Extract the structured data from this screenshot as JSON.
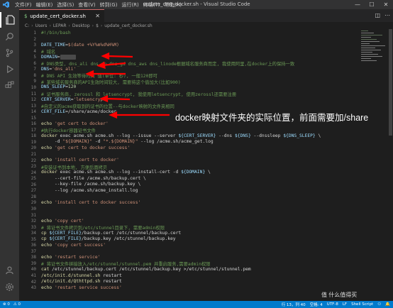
{
  "titlebar": {
    "menu": [
      "文件(F)",
      "编辑(E)",
      "选择(S)",
      "查看(V)",
      "转到(G)",
      "运行(R)",
      "终端(T)",
      "帮助(H)"
    ],
    "title": "update_cert_docker.sh - Visual Studio Code",
    "controls": [
      "—",
      "☐",
      "✕"
    ]
  },
  "tab": {
    "label": "update_cert_docker.sh",
    "icon_text": "$",
    "close": "✕"
  },
  "breadcrumb": [
    "C:",
    "Users",
    "LEPAR",
    "Desktop",
    "$",
    "update_cert_docker.sh"
  ],
  "editor": {
    "lines": [
      [
        [
          "#!/bin/bash",
          "comment"
        ]
      ],
      [],
      [
        [
          "DATE_TIME",
          "var"
        ],
        [
          "=",
          "op"
        ],
        [
          "$(date +%Y%m%d%H%M)",
          "str"
        ]
      ],
      [
        [
          "# 域名",
          "comment"
        ]
      ],
      [
        [
          "DOMAIN",
          "var"
        ],
        [
          "=",
          "op"
        ],
        [
          "██████",
          "blur"
        ]
      ],
      [
        [
          "# DNS类型, dns_ali dns_dp dns_gd dns_aws dns_linode根据域名服务商而定, 我使用阿里,在docker上的保持一致",
          "comment"
        ]
      ],
      [
        [
          "DNS",
          "var"
        ],
        [
          "=",
          "op"
        ],
        [
          "'dns_ali'",
          "str"
        ]
      ],
      [
        [
          "# DNS API 生效等待时间 值(单位: 秒), 一般120即可",
          "comment"
        ]
      ],
      [
        [
          "# 某些域名服务商的API生效时间较大, 需要将这个值加大(比如900)",
          "comment"
        ]
      ],
      [
        [
          "DNS_SLEEP",
          "var"
        ],
        [
          "=",
          "op"
        ],
        [
          "120",
          "num"
        ]
      ],
      [
        [
          "# 证书服务商, zerossl 和 letsencrypt, 我使用letsencrypt, 使用zerossl还需要注册",
          "comment"
        ]
      ],
      [
        [
          "CERT_SERVER",
          "var"
        ],
        [
          "=",
          "op"
        ],
        [
          "'letsencrypt'",
          "str"
        ]
      ],
      [
        [
          "#自定义的acme获取到的证书的位置--与docker映射的文件夹相同",
          "comment"
        ]
      ],
      [
        [
          "CERT_FILE",
          "var"
        ],
        [
          "=",
          "op"
        ],
        [
          "/share/acme/docker",
          "op"
        ]
      ],
      [],
      [
        [
          "echo",
          "cmd"
        ],
        [
          " ",
          "op"
        ],
        [
          "'get cert to docker'",
          "str"
        ]
      ],
      [
        [
          "#执行docker容器证书文件",
          "comment"
        ]
      ],
      [
        [
          "docker",
          "cmd"
        ],
        [
          " exec acme.sh acme.sh --log --issue --server ",
          "op"
        ],
        [
          "${CERT_SERVER}",
          "var"
        ],
        [
          " --dns ",
          "op"
        ],
        [
          "${DNS}",
          "var"
        ],
        [
          " --dnssleep ",
          "op"
        ],
        [
          "${DNS_SLEEP}",
          "var"
        ],
        [
          " \\",
          "op"
        ]
      ],
      [
        [
          "     -d ",
          "op"
        ],
        [
          "\"${DOMAIN}\"",
          "str"
        ],
        [
          " -d ",
          "op"
        ],
        [
          "\"*.${DOMAIN}\"",
          "str"
        ],
        [
          " --log /acme.sh/acme_get.log",
          "op"
        ]
      ],
      [
        [
          "echo",
          "cmd"
        ],
        [
          " ",
          "op"
        ],
        [
          "'get cert to docker success'",
          "str"
        ]
      ],
      [],
      [
        [
          "echo",
          "cmd"
        ],
        [
          " ",
          "op"
        ],
        [
          "'install cert to docker'",
          "str"
        ]
      ],
      [
        [
          "#安装证书到本地, 方便后面拷贝",
          "comment"
        ]
      ],
      [
        [
          "docker",
          "cmd"
        ],
        [
          " exec acme.sh acme.sh --log --install-cert -d ",
          "op"
        ],
        [
          "${DOMAIN}",
          "var"
        ],
        [
          " \\",
          "op"
        ]
      ],
      [
        [
          "     --cert-file /acme.sh/backup.cert \\",
          "op"
        ]
      ],
      [
        [
          "     --key-file /acme.sh/backup.key \\",
          "op"
        ]
      ],
      [
        [
          "     --log /acme.sh/acme_install.log",
          "op"
        ]
      ],
      [],
      [
        [
          "echo",
          "cmd"
        ],
        [
          " ",
          "op"
        ],
        [
          "'install cert to docker success'",
          "str"
        ]
      ],
      [],
      [],
      [
        [
          "echo",
          "cmd"
        ],
        [
          " ",
          "op"
        ],
        [
          "'copy cert'",
          "str"
        ]
      ],
      [
        [
          "# 将证书文件拷贝到/etc/stunnel目录下, 需要admin权限",
          "comment"
        ]
      ],
      [
        [
          "cp",
          "cmd"
        ],
        [
          " ",
          "op"
        ],
        [
          "${CERT_FILE}",
          "var"
        ],
        [
          "/backup.cert /etc/stunnel/backup.cert",
          "op"
        ]
      ],
      [
        [
          "cp",
          "cmd"
        ],
        [
          " ",
          "op"
        ],
        [
          "${CERT_FILE}",
          "var"
        ],
        [
          "/backup.key /etc/stunnel/backup.key",
          "op"
        ]
      ],
      [
        [
          "echo",
          "cmd"
        ],
        [
          " ",
          "op"
        ],
        [
          "'copy cert success'",
          "str"
        ]
      ],
      [],
      [
        [
          "echo",
          "cmd"
        ],
        [
          " ",
          "op"
        ],
        [
          "'restart service'",
          "str"
        ]
      ],
      [
        [
          "# 将证书文件拼接放入/etc/stunnel/stunnel.pem 并重启服务,需要admin权限",
          "comment"
        ]
      ],
      [
        [
          "cat",
          "cmd"
        ],
        [
          " /etc/stunnel/backup.cert /etc/stunnel/backup.key >/etc/stunnel/stunnel.pem",
          "op"
        ]
      ],
      [
        [
          "/etc/init.d/stunnel.sh",
          "cmd"
        ],
        [
          " restart",
          "op"
        ]
      ],
      [
        [
          "/etc/init.d/Qthttpd.sh",
          "cmd"
        ],
        [
          " restart",
          "op"
        ]
      ],
      [
        [
          "echo",
          "cmd"
        ],
        [
          " ",
          "op"
        ],
        [
          "'restart service success'",
          "str"
        ]
      ]
    ]
  },
  "annotation": {
    "text": "docker映射文件夹的实际位置，前面需要加/share",
    "color": "#ff0000"
  },
  "watermark": "值 什么值得买",
  "statusbar": {
    "left": [
      "⊗ 0",
      "⚠ 0"
    ],
    "right": [
      "行 13，列 40",
      "空格: 4",
      "UTF-8",
      "LF",
      "Shell Script",
      "⚇",
      "🔔"
    ]
  },
  "colors": {
    "titlebar": "#323233",
    "activitybar": "#333333",
    "editor_bg": "#1e1e1e",
    "statusbar": "#007acc"
  }
}
